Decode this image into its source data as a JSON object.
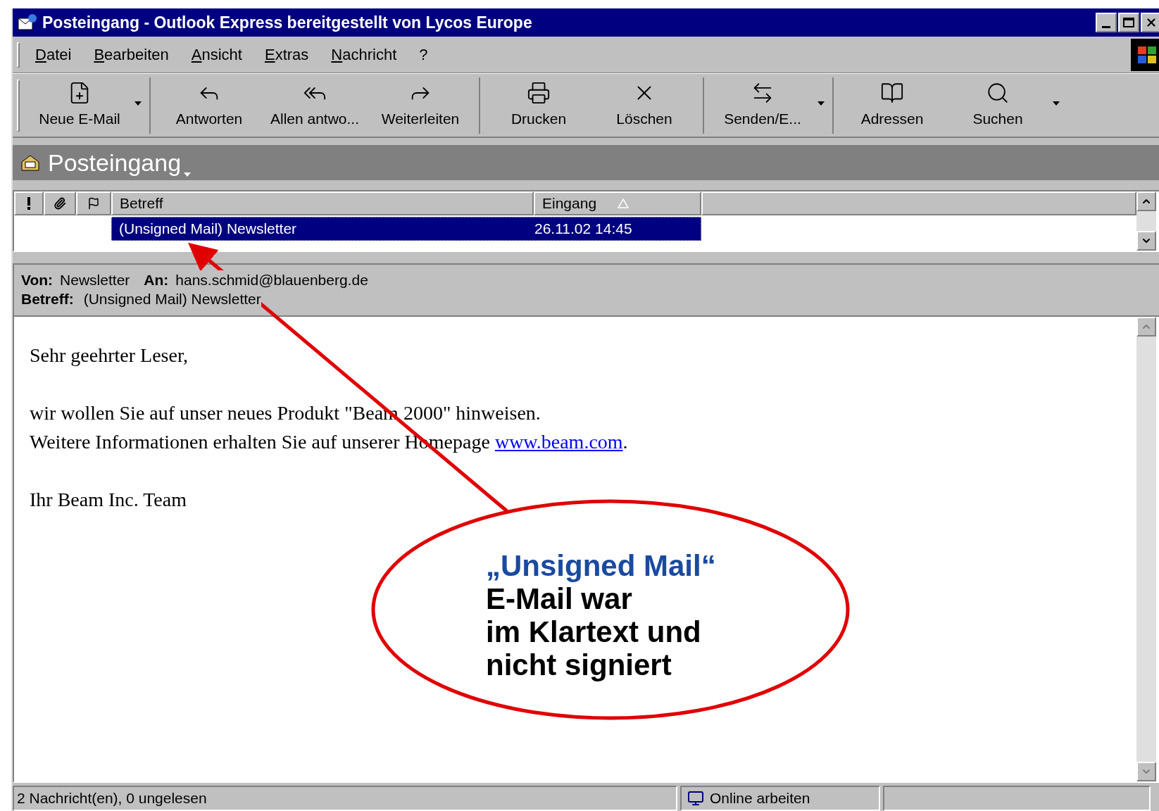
{
  "window": {
    "title": "Posteingang - Outlook Express bereitgestellt von Lycos Europe"
  },
  "menu": [
    "Datei",
    "Bearbeiten",
    "Ansicht",
    "Extras",
    "Nachricht",
    "?"
  ],
  "toolbar": [
    [
      {
        "label": "Neue E-Mail",
        "kind": "new",
        "dropdown": true
      }
    ],
    [
      {
        "label": "Antworten",
        "kind": "reply",
        "dropdown": false
      },
      {
        "label": "Allen antwo...",
        "kind": "reply_all",
        "dropdown": false
      },
      {
        "label": "Weiterleiten",
        "kind": "forward",
        "dropdown": false
      }
    ],
    [
      {
        "label": "Drucken",
        "kind": "print",
        "dropdown": false
      },
      {
        "label": "Löschen",
        "kind": "delete",
        "dropdown": false
      }
    ],
    [
      {
        "label": "Senden/E...",
        "kind": "send",
        "dropdown": true
      }
    ],
    [
      {
        "label": "Adressen",
        "kind": "addresses",
        "dropdown": false
      },
      {
        "label": "Suchen",
        "kind": "find",
        "dropdown": true
      }
    ]
  ],
  "folder": {
    "title": "Posteingang"
  },
  "list": {
    "columns": [
      {
        "kind": "priority"
      },
      {
        "kind": "attachment"
      },
      {
        "kind": "flag"
      },
      {
        "kind": "text",
        "label": "Betreff",
        "sorted": false
      },
      {
        "kind": "text",
        "label": "Eingang",
        "sorted": true
      }
    ],
    "rows": [
      {
        "subject": "(Unsigned Mail) Newsletter",
        "received": "26.11.02 14:45",
        "selected": true
      }
    ]
  },
  "preview": {
    "from_label": "Von:",
    "from": "Newsletter",
    "to_label": "An:",
    "to": "hans.schmid@blauenberg.de",
    "subject_label": "Betreff:",
    "subject": "(Unsigned Mail) Newsletter"
  },
  "body": [
    [
      {
        "text": "Sehr geehrter Leser,"
      }
    ],
    [
      {
        "text": "wir wollen Sie auf unser neues Produkt \"Beam 2000\" hinweisen."
      },
      {
        "text": "Weitere Informationen erhalten Sie auf unserer Homepage ",
        "link": "www.beam.com",
        "after": "."
      }
    ],
    [
      {
        "text": "Ihr Beam Inc. Team"
      }
    ]
  ],
  "status_bar": {
    "messages": "2 Nachricht(en), 0 ungelesen",
    "connection": "Online arbeiten"
  },
  "annotation": {
    "title": "„Unsigned Mail“",
    "lines": [
      "E-Mail war",
      "im Klartext und",
      "nicht signiert"
    ]
  }
}
